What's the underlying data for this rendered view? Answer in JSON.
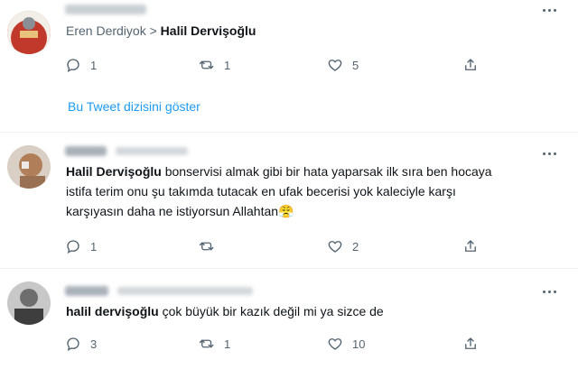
{
  "tweets": [
    {
      "reply_from": "Eren Derdiyok",
      "reply_sep": ">",
      "reply_to": "Halil Dervişoğlu",
      "stats": {
        "replies": "1",
        "retweets": "1",
        "likes": "5"
      },
      "show_thread": "Bu Tweet dizisini göster"
    },
    {
      "mention": "Halil Dervişoğlu",
      "lines": [
        " bonservisi almak gibi bir hata yaparsak ilk sıra ben hocaya",
        "istifa terim onu şu takımda tutacak en ufak becerisi yok kaleciyle karşı",
        "karşıyasın daha ne istiyorsun Allahtan😤"
      ],
      "stats": {
        "replies": "1",
        "retweets": "",
        "likes": "2"
      }
    },
    {
      "mention": "halil dervişoğlu",
      "text": " çok büyük bir kazık değil mi ya sizce de",
      "stats": {
        "replies": "3",
        "retweets": "1",
        "likes": "10"
      }
    }
  ],
  "icons": [
    "reply-icon",
    "retweet-icon",
    "like-icon",
    "share-icon",
    "more-icon"
  ],
  "colors": {
    "link": "#1d9bf0",
    "secondary_text": "#536471",
    "divider": "#eff3f4"
  }
}
